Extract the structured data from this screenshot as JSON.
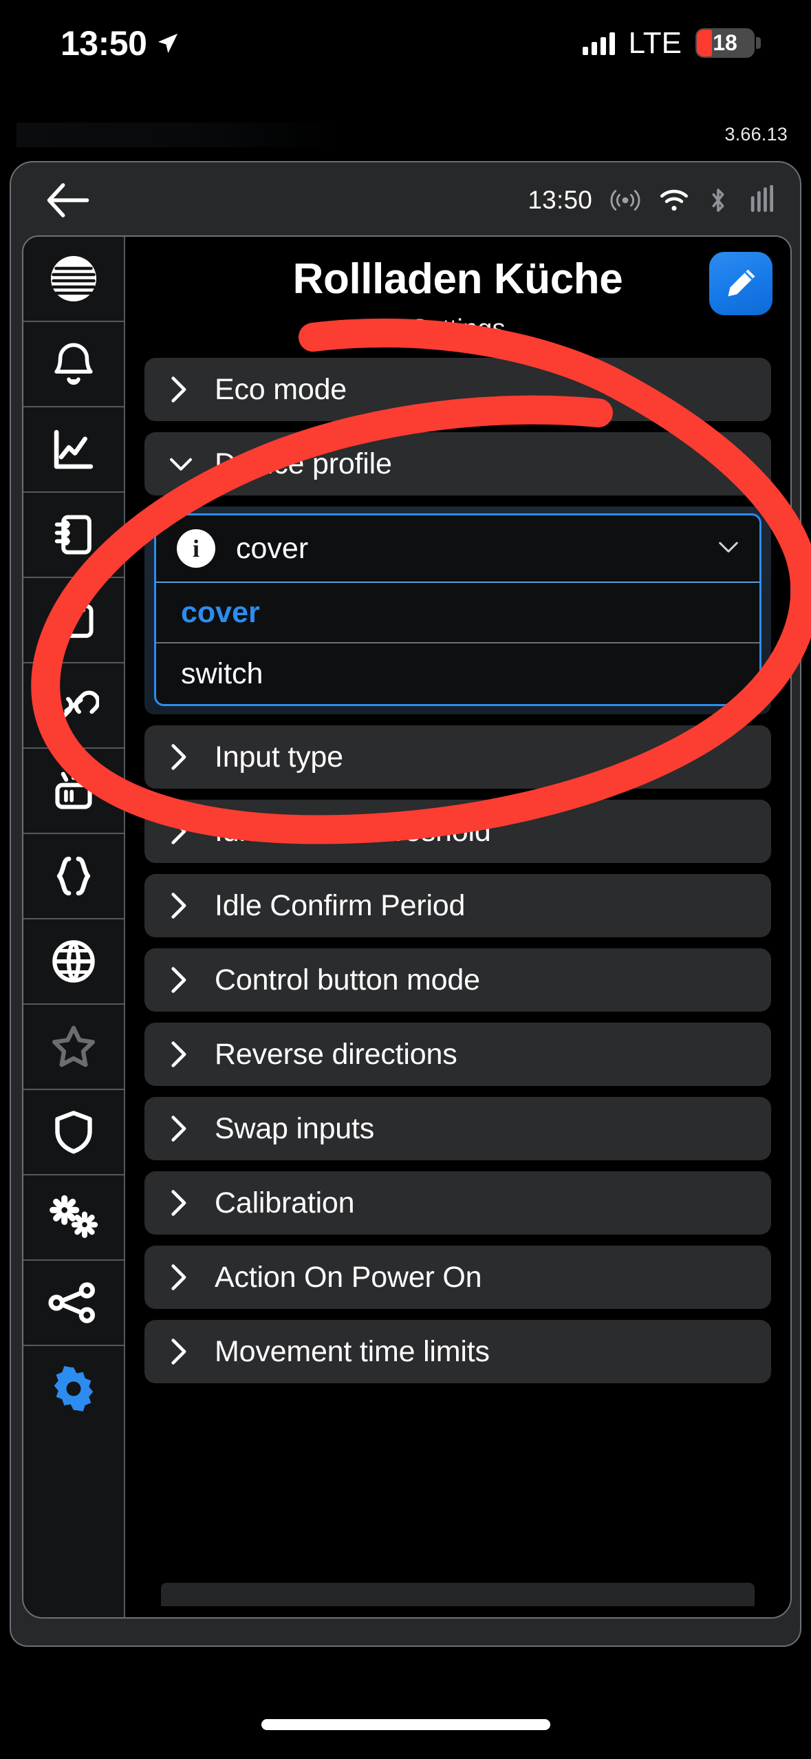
{
  "status_bar": {
    "time": "13:50",
    "location_icon": "location-arrow-icon",
    "signal_icon": "cellular-signal-icon",
    "network": "LTE",
    "battery_level": "18",
    "battery_color": "#ff3b30"
  },
  "version": "3.66.13",
  "app_nav": {
    "back_icon": "back-arrow-icon",
    "time": "13:50",
    "icons": [
      "broadcast-icon",
      "wifi-icon",
      "bluetooth-icon",
      "cellular-icon"
    ]
  },
  "header": {
    "title": "Rollladen Küche",
    "edit_icon": "pencil-icon",
    "subtitle": "Settings",
    "accent_color": "#2d8cf0"
  },
  "sidebar": {
    "items": [
      {
        "name": "log-icon",
        "label": "Log"
      },
      {
        "name": "bell-icon",
        "label": "Notifications"
      },
      {
        "name": "chart-icon",
        "label": "Statistics"
      },
      {
        "name": "notebook-icon",
        "label": "Notebook"
      },
      {
        "name": "calendar-icon",
        "label": "Schedule"
      },
      {
        "name": "link-icon",
        "label": "Links"
      },
      {
        "name": "device-icon",
        "label": "Device"
      },
      {
        "name": "braces-icon",
        "label": "Script"
      },
      {
        "name": "globe-icon",
        "label": "Network"
      },
      {
        "name": "star-icon",
        "label": "Favorites"
      },
      {
        "name": "shield-icon",
        "label": "Security"
      },
      {
        "name": "gears-icon",
        "label": "Advanced"
      },
      {
        "name": "share-nodes-icon",
        "label": "Share"
      },
      {
        "name": "gear-icon",
        "label": "Settings"
      }
    ],
    "active_index": 13
  },
  "settings_list": [
    {
      "label": "Eco mode",
      "expanded": false,
      "chevron": "chevron-right-icon"
    },
    {
      "label": "Device profile",
      "expanded": true,
      "chevron": "chevron-down-icon"
    },
    {
      "label": "Input type",
      "expanded": false,
      "chevron": "chevron-right-icon"
    },
    {
      "label": "Idle Power Threshold",
      "expanded": false,
      "chevron": "chevron-right-icon"
    },
    {
      "label": "Idle Confirm Period",
      "expanded": false,
      "chevron": "chevron-right-icon"
    },
    {
      "label": "Control button mode",
      "expanded": false,
      "chevron": "chevron-right-icon"
    },
    {
      "label": "Reverse directions",
      "expanded": false,
      "chevron": "chevron-right-icon"
    },
    {
      "label": "Swap inputs",
      "expanded": false,
      "chevron": "chevron-right-icon"
    },
    {
      "label": "Calibration",
      "expanded": false,
      "chevron": "chevron-right-icon"
    },
    {
      "label": "Action On Power On",
      "expanded": false,
      "chevron": "chevron-right-icon"
    },
    {
      "label": "Movement time limits",
      "expanded": false,
      "chevron": "chevron-right-icon"
    }
  ],
  "dropdown": {
    "info_icon": "info-icon",
    "selected_value": "cover",
    "caret_icon": "chevron-down-icon",
    "options": [
      {
        "label": "cover",
        "selected": true
      },
      {
        "label": "switch",
        "selected": false
      }
    ]
  },
  "annotation": {
    "type": "hand-drawn-red-circle",
    "color": "#ff3b30"
  }
}
